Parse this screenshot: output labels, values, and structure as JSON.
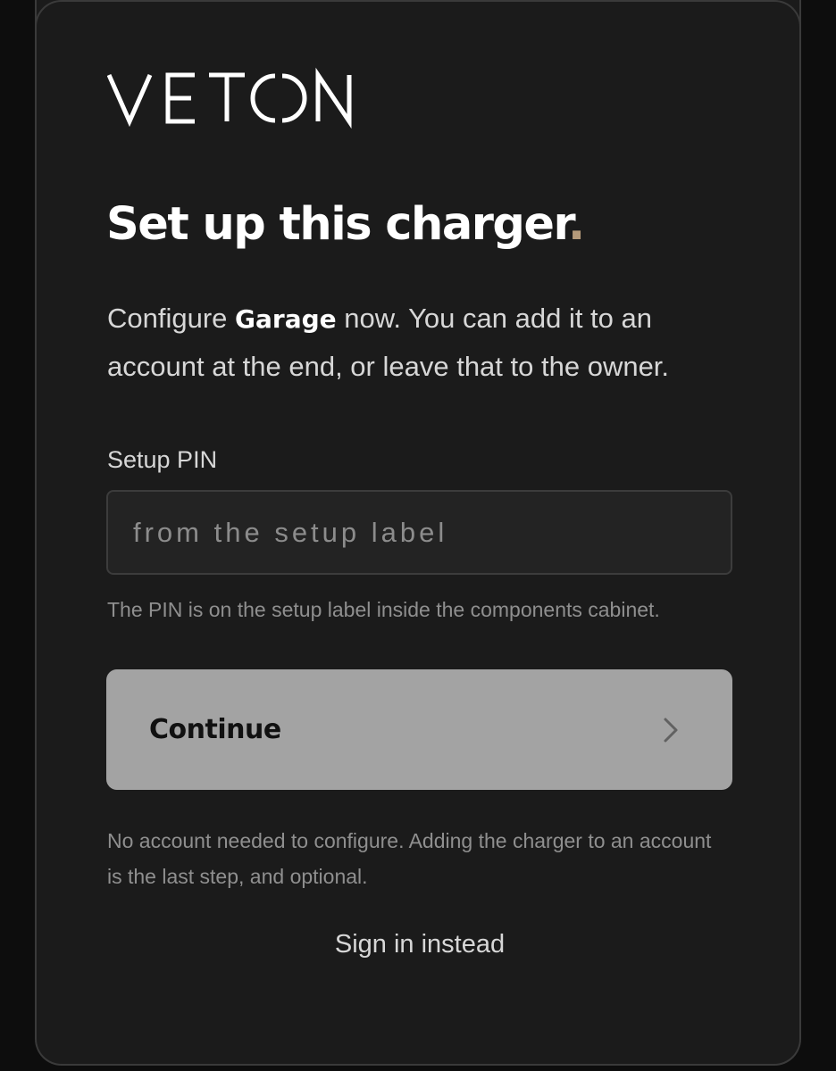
{
  "brand": {
    "name": "VETON",
    "accent_color": "#b59a7a"
  },
  "header": {
    "title": "Set up this charger",
    "title_dot": "."
  },
  "intro": {
    "prefix": "Configure ",
    "charger_name": "Garage",
    "suffix": " now. You can add it to an account at the end, or leave that to the owner."
  },
  "pin_field": {
    "label": "Setup PIN",
    "value": "",
    "placeholder": "from the setup label",
    "hint": "The PIN is on the setup label inside the components cabinet."
  },
  "continue_button": {
    "label": "Continue",
    "icon": "chevron-right-icon"
  },
  "note": "No account needed to configure. Adding the charger to an account is the last step, and optional.",
  "sign_in_link": "Sign in instead"
}
